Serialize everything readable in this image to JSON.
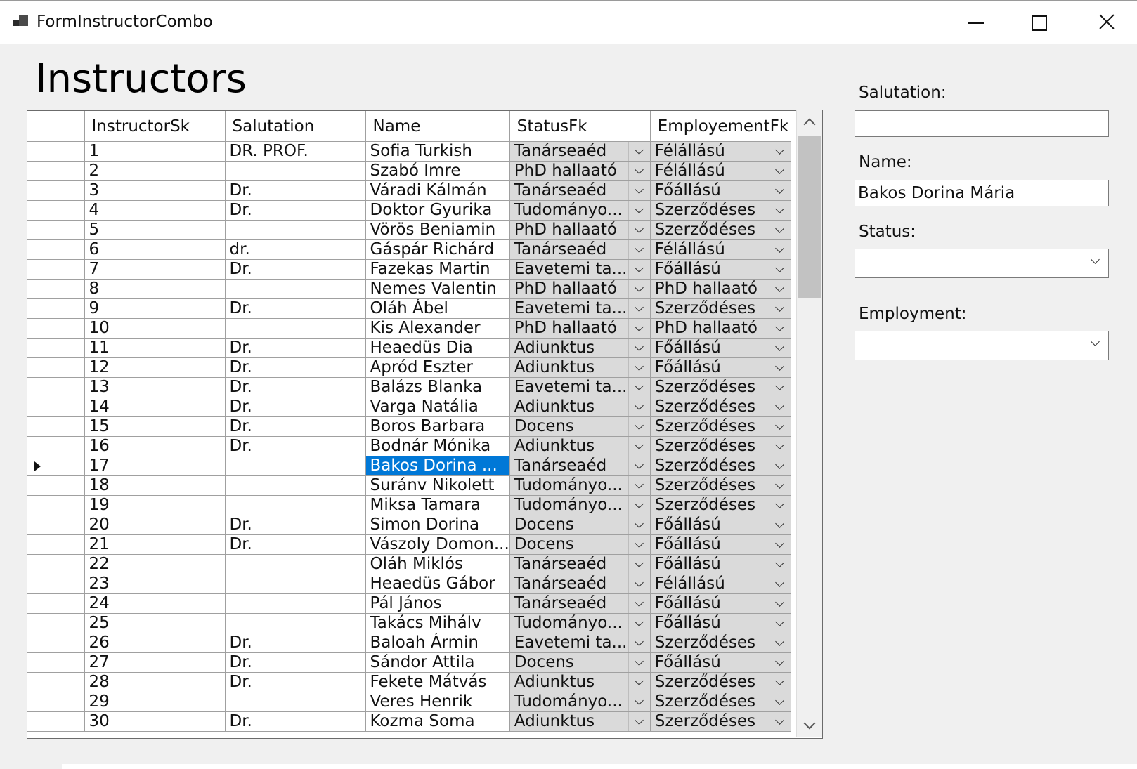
{
  "window": {
    "title": "FormInstructorCombo"
  },
  "heading": "Instructors",
  "grid": {
    "columns": [
      "",
      "InstructorSk",
      "Salutation",
      "Name",
      "StatusFk",
      "EmployementFk"
    ],
    "current_row_index": 16,
    "rows": [
      {
        "id": "1",
        "salutation": "DR. PROF.",
        "name": "Sofia Turkish",
        "status": "Tanárseaéd",
        "employment": "Félállású"
      },
      {
        "id": "2",
        "salutation": "",
        "name": "Szabó Imre",
        "status": "PhD hallaató",
        "employment": "Félállású"
      },
      {
        "id": "3",
        "salutation": "Dr.",
        "name": "Váradi Kálmán",
        "status": "Tanárseaéd",
        "employment": "Főállású"
      },
      {
        "id": "4",
        "salutation": "Dr.",
        "name": "Doktor Gyurika",
        "status": "Tudományo...",
        "employment": "Szerződéses"
      },
      {
        "id": "5",
        "salutation": "",
        "name": "Vörös Beniamin",
        "status": "PhD hallaató",
        "employment": "Szerződéses"
      },
      {
        "id": "6",
        "salutation": "dr.",
        "name": "Gáspár Richárd",
        "status": "Tanárseaéd",
        "employment": "Félállású"
      },
      {
        "id": "7",
        "salutation": "Dr.",
        "name": "Fazekas Martin",
        "status": "Eavetemi ta...",
        "employment": "Főállású"
      },
      {
        "id": "8",
        "salutation": "",
        "name": "Nemes Valentin",
        "status": "PhD hallaató",
        "employment": "PhD hallaató"
      },
      {
        "id": "9",
        "salutation": "Dr.",
        "name": "Oláh Ábel",
        "status": "Eavetemi ta...",
        "employment": "Szerződéses"
      },
      {
        "id": "10",
        "salutation": "",
        "name": "Kis Alexander",
        "status": "PhD hallaató",
        "employment": "PhD hallaató"
      },
      {
        "id": "11",
        "salutation": "Dr.",
        "name": "Heaedüs Dia",
        "status": "Adiunktus",
        "employment": "Főállású"
      },
      {
        "id": "12",
        "salutation": "Dr.",
        "name": "Apród Eszter",
        "status": "Adiunktus",
        "employment": "Főállású"
      },
      {
        "id": "13",
        "salutation": "Dr.",
        "name": "Balázs Blanka",
        "status": "Eavetemi ta...",
        "employment": "Szerződéses"
      },
      {
        "id": "14",
        "salutation": "Dr.",
        "name": "Varga Natália",
        "status": "Adiunktus",
        "employment": "Szerződéses"
      },
      {
        "id": "15",
        "salutation": "Dr.",
        "name": "Boros Barbara",
        "status": "Docens",
        "employment": "Szerződéses"
      },
      {
        "id": "16",
        "salutation": "Dr.",
        "name": "Bodnár Mónika",
        "status": "Adiunktus",
        "employment": "Szerződéses"
      },
      {
        "id": "17",
        "salutation": "",
        "name": "Bakos Dorina ...",
        "status": "Tanárseaéd",
        "employment": "Szerződéses"
      },
      {
        "id": "18",
        "salutation": "",
        "name": "Suránv Nikolett",
        "status": "Tudományo...",
        "employment": "Szerződéses"
      },
      {
        "id": "19",
        "salutation": "",
        "name": "Miksa Tamara",
        "status": "Tudományo...",
        "employment": "Szerződéses"
      },
      {
        "id": "20",
        "salutation": "Dr.",
        "name": "Simon Dorina",
        "status": "Docens",
        "employment": "Főállású"
      },
      {
        "id": "21",
        "salutation": "Dr.",
        "name": "Vászoly Domon...",
        "status": "Docens",
        "employment": "Főállású"
      },
      {
        "id": "22",
        "salutation": "",
        "name": "Oláh Miklós",
        "status": "Tanárseaéd",
        "employment": "Főállású"
      },
      {
        "id": "23",
        "salutation": "",
        "name": "Heaedüs Gábor",
        "status": "Tanárseaéd",
        "employment": "Félállású"
      },
      {
        "id": "24",
        "salutation": "",
        "name": "Pál János",
        "status": "Tanárseaéd",
        "employment": "Főállású"
      },
      {
        "id": "25",
        "salutation": "",
        "name": "Takács Mihálv",
        "status": "Tudományo...",
        "employment": "Főállású"
      },
      {
        "id": "26",
        "salutation": "Dr.",
        "name": "Baloah Ármin",
        "status": "Eavetemi ta...",
        "employment": "Szerződéses"
      },
      {
        "id": "27",
        "salutation": "Dr.",
        "name": "Sándor Attila",
        "status": "Docens",
        "employment": "Főállású"
      },
      {
        "id": "28",
        "salutation": "Dr.",
        "name": "Fekete Mátvás",
        "status": "Adiunktus",
        "employment": "Szerződéses"
      },
      {
        "id": "29",
        "salutation": "",
        "name": "Veres Henrik",
        "status": "Tudományo...",
        "employment": "Szerződéses"
      },
      {
        "id": "30",
        "salutation": "Dr.",
        "name": "Kozma Soma",
        "status": "Adiunktus",
        "employment": "Szerződéses"
      }
    ]
  },
  "form": {
    "salutation_label": "Salutation:",
    "salutation_value": "",
    "name_label": "Name:",
    "name_value": "Bakos Dorina Mária",
    "status_label": "Status:",
    "status_value": "",
    "employment_label": "Employment:",
    "employment_value": ""
  },
  "icons": {
    "window": "app-window-icon",
    "row_indicator": "current-row-arrow-icon",
    "dropdown": "chevron-down-icon"
  },
  "colors": {
    "selection": "#0078d7",
    "combo_cell": "#dadada",
    "window_bg": "#f0f0f0"
  }
}
